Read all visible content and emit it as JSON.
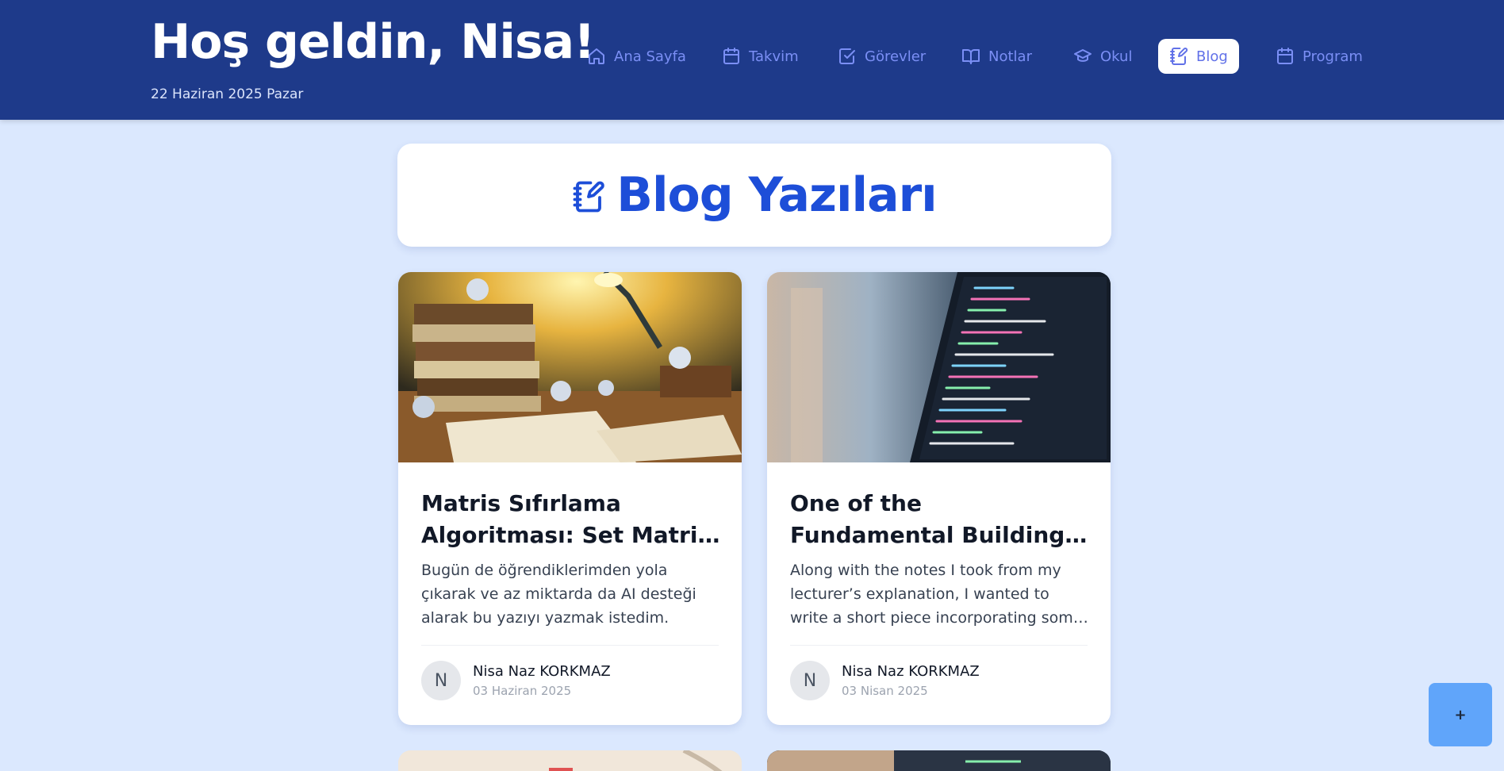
{
  "header": {
    "greeting": "Hoş geldin, Nisa!",
    "date": "22 Haziran 2025 Pazar"
  },
  "nav": {
    "items": [
      {
        "label": "Ana Sayfa",
        "icon": "home-icon"
      },
      {
        "label": "Takvim",
        "icon": "calendar-icon"
      },
      {
        "label": "Görevler",
        "icon": "check-square-icon"
      },
      {
        "label": "Notlar",
        "icon": "book-open-icon"
      },
      {
        "label": "Okul",
        "icon": "graduation-cap-icon"
      },
      {
        "label": "Blog",
        "icon": "notebook-pen-icon",
        "active": true
      },
      {
        "label": "Program",
        "icon": "calendar-icon"
      }
    ]
  },
  "page": {
    "title": "Blog Yazıları",
    "title_icon": "notebook-pen-icon"
  },
  "posts": [
    {
      "title": "Matris Sıfırlama Algoritması: Set Matrix Zeroes",
      "excerpt": "Bugün de öğrendiklerimden yola çıkarak ve az miktarda da AI desteği alarak bu yazıyı yazmak istedim.",
      "author_initial": "N",
      "author": "Nisa Naz KORKMAZ",
      "date": "03 Haziran 2025"
    },
    {
      "title": "One of the Fundamental Building Blocks of Data Structures",
      "excerpt": "Along with the notes I took from my lecturer’s explanation, I wanted to write a short piece incorporating some small examples.",
      "author_initial": "N",
      "author": "Nisa Naz KORKMAZ",
      "date": "03 Nisan 2025"
    }
  ],
  "fab": {
    "label": "+"
  },
  "colors": {
    "header_bg": "#1e3a8a",
    "page_bg": "#dbe8fe",
    "accent": "#1d4ed8",
    "nav_text": "#7b8ff5",
    "fab_bg": "#60a5fa"
  }
}
